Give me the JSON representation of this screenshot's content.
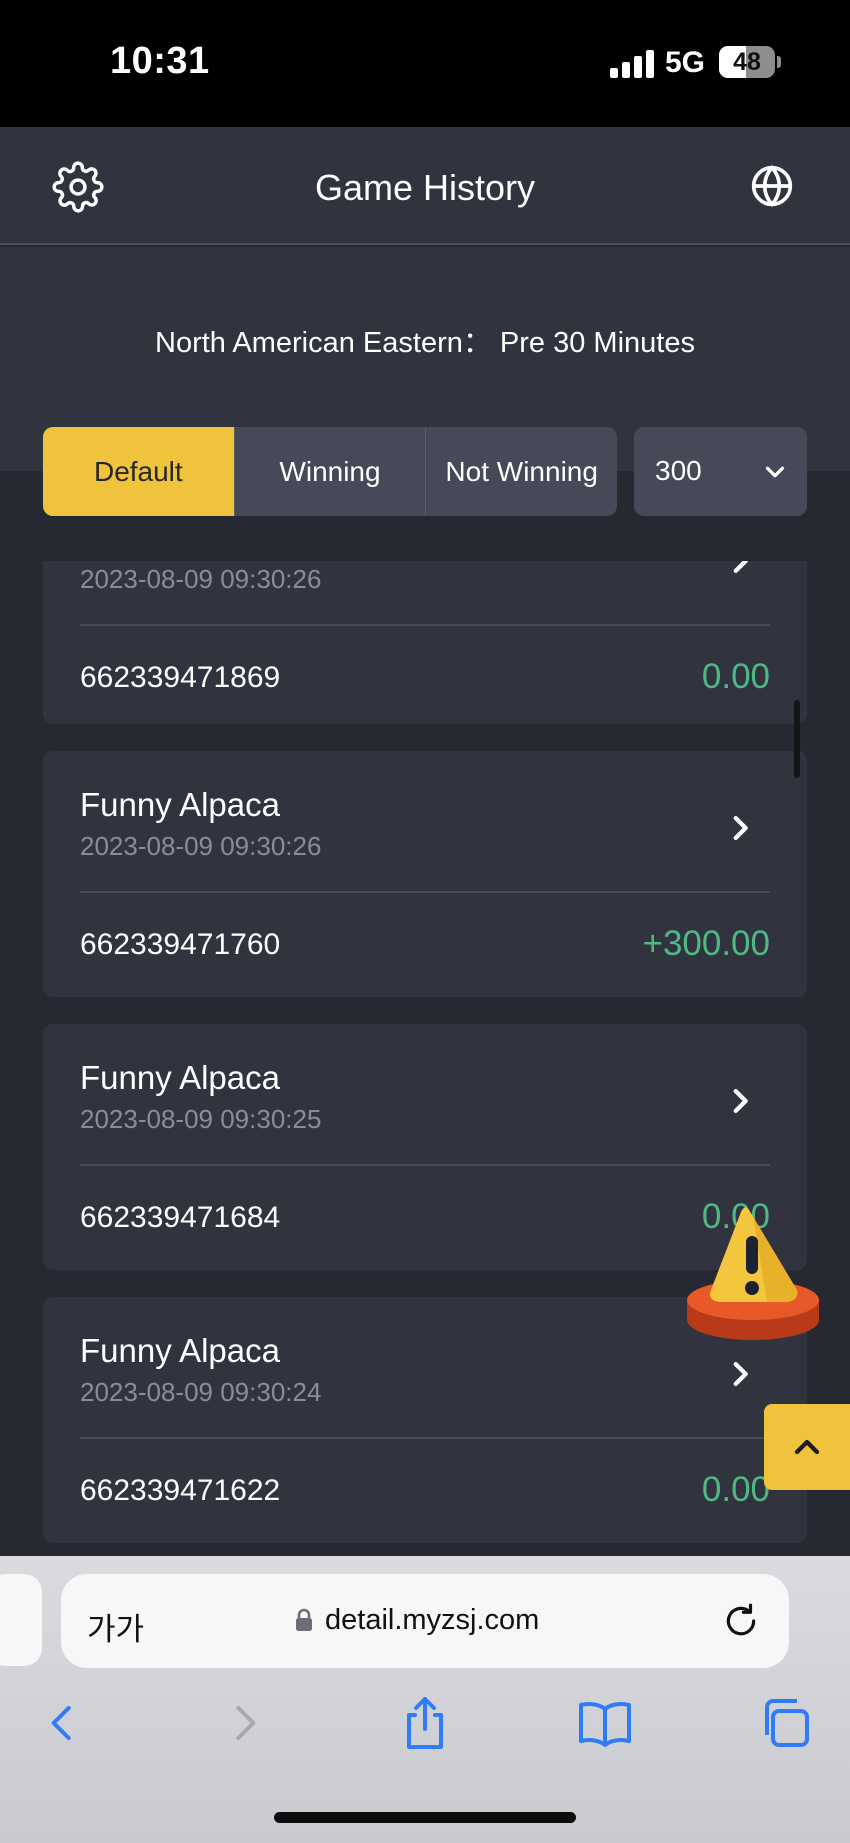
{
  "status_bar": {
    "time": "10:31",
    "network": "5G",
    "battery": "48"
  },
  "header": {
    "title": "Game History"
  },
  "info": {
    "timezone_text": "North American Eastern： Pre 30 Minutes"
  },
  "filters": {
    "tabs": [
      {
        "label": "Default",
        "active": true
      },
      {
        "label": "Winning",
        "active": false
      },
      {
        "label": "Not Winning",
        "active": false
      }
    ],
    "amount_select": {
      "value": "300"
    }
  },
  "records": [
    {
      "title": "",
      "date": "2023-08-09 09:30:26",
      "id": "662339471869",
      "amount": "0.00"
    },
    {
      "title": "Funny Alpaca",
      "date": "2023-08-09 09:30:26",
      "id": "662339471760",
      "amount": "+300.00"
    },
    {
      "title": "Funny Alpaca",
      "date": "2023-08-09 09:30:25",
      "id": "662339471684",
      "amount": "0.00"
    },
    {
      "title": "Funny Alpaca",
      "date": "2023-08-09 09:30:24",
      "id": "662339471622",
      "amount": "0.00"
    }
  ],
  "browser": {
    "text_size_label": "가가",
    "url": "detail.myzsj.com"
  },
  "colors": {
    "accent": "#f0c33c",
    "positive": "#4fb985",
    "background": "#262832",
    "card": "#31333f"
  },
  "icons": {
    "settings": "gear-icon",
    "language": "globe-icon",
    "dropdown": "chevron-down-icon",
    "record": "chevron-right-icon",
    "alert": "warning-icon",
    "back_to_top": "chevron-up-icon"
  }
}
